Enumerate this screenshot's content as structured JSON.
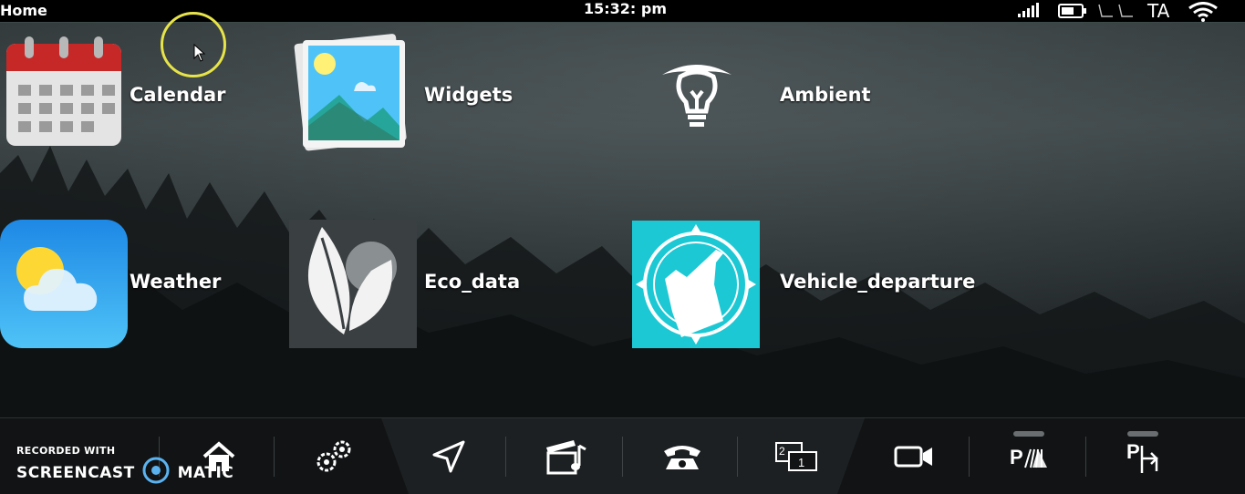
{
  "status_bar": {
    "title": "Home",
    "time": "15:32: pm",
    "region": "TA",
    "icons": [
      "signal-icon",
      "battery-icon",
      "seat-icon",
      "wifi-icon"
    ]
  },
  "apps": [
    {
      "id": "calendar",
      "label": "Calendar",
      "icon": "calendar-icon"
    },
    {
      "id": "widgets",
      "label": "Widgets",
      "icon": "image-gallery-icon"
    },
    {
      "id": "ambient",
      "label": "Ambient",
      "icon": "lightbulb-icon"
    },
    {
      "id": "weather",
      "label": "Weather",
      "icon": "sun-cloud-icon"
    },
    {
      "id": "eco_data",
      "label": "Eco_data",
      "icon": "leaf-icon"
    },
    {
      "id": "vehicle_departure",
      "label": "Vehicle_departure",
      "icon": "compass-fuel-icon"
    }
  ],
  "dock": {
    "items": [
      "home-icon",
      "settings-gears-icon",
      "navigation-icon",
      "media-icon",
      "phone-icon",
      "screen-switch-icon",
      "camera-icon",
      "park-assist-icon",
      "park-exit-icon"
    ],
    "screen_switch_numbers": [
      "2",
      "1"
    ],
    "park_letter": "P"
  },
  "watermark": {
    "line1": "RECORDED WITH",
    "line2a": "SCREENCAST",
    "line2b": "MATIC"
  },
  "colors": {
    "accent_teal": "#1cc8d4",
    "cursor_ring": "#e7e44a",
    "status_bar": "#000000"
  }
}
